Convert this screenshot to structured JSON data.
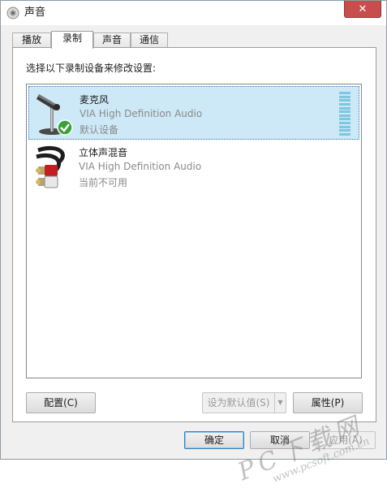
{
  "window": {
    "title": "声音",
    "close_label": "✕"
  },
  "tabs": [
    {
      "label": "播放",
      "active": false
    },
    {
      "label": "录制",
      "active": true
    },
    {
      "label": "声音",
      "active": false
    },
    {
      "label": "通信",
      "active": false
    }
  ],
  "panel": {
    "instruction": "选择以下录制设备来修改设置:",
    "devices": [
      {
        "name": "麦克风",
        "driver": "VIA High Definition Audio",
        "status": "默认设备",
        "icon": "microphone-icon",
        "selected": true,
        "default_badge": "green-check-icon"
      },
      {
        "name": "立体声混音",
        "driver": "VIA High Definition Audio",
        "status": "当前不可用",
        "icon": "stereo-cable-icon",
        "selected": false
      }
    ]
  },
  "buttons": {
    "configure": "配置(C)",
    "set_default": "设为默认值(S)",
    "properties": "属性(P)",
    "ok": "确定",
    "cancel": "取消",
    "apply": "应用(A)"
  },
  "watermark": {
    "brand": "PC下载网",
    "url": "www.pcsoft.com.cn"
  },
  "colors": {
    "selection": "#cde8f7",
    "close_button": "#c84d4d",
    "level_meter": "#7fc6e0",
    "check": "#3aa23a"
  }
}
